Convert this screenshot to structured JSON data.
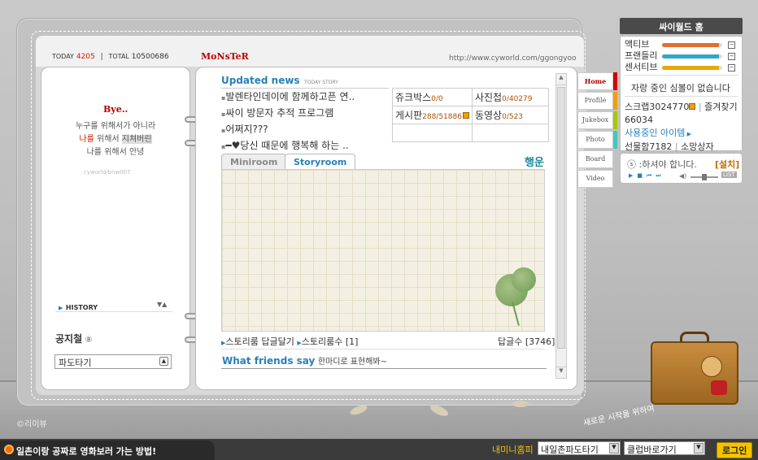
{
  "header": {
    "today_label": "TODAY",
    "today_count": "4205",
    "divider": "|",
    "total_label": "TOTAL",
    "total_count": "10500686",
    "title": "MoNsTeR",
    "url": "http://www.cyworld.com/ggongyoo"
  },
  "left_panel": {
    "bye": "Bye..",
    "poem": {
      "line1": "누구를 위해서가 아니라",
      "line2_highlight": "나를",
      "line2_rest": " 위해서 ",
      "line2_box": "지쳐버린",
      "line3": "나를 위해서 안녕"
    },
    "signature": "cyworld/bnw007",
    "history_label": "HISTORY",
    "notice_title": "공지철",
    "notice_icon": "circled-8",
    "notice_select": "파도타기"
  },
  "main": {
    "updated_news_title": "Updated news",
    "today_story": "TODAY STORY",
    "news": [
      "발렌타인데이에 함께하고픈 연..",
      "싸이 방문자 추적 프로그램",
      "어쩌지???",
      "━♥당신 때문에 행복해 하는 .."
    ],
    "menu_grid": [
      {
        "label": "쥬크박스",
        "count": "0/0"
      },
      {
        "label": "사진첩",
        "count": "0/40279"
      },
      {
        "label": "게시판",
        "count": "288/51886"
      },
      {
        "label": "동영상",
        "count": "0/523"
      }
    ],
    "tabs": [
      "Miniroom",
      "Storyroom"
    ],
    "active_tab": "Storyroom",
    "mood": "행운",
    "story_links": [
      "스토리룸 답글달기",
      "스토리룸수 [1]"
    ],
    "reply_count": "답글수 [3746]",
    "friends_title": "What friends say",
    "friends_text": "한마디로 표현해봐~"
  },
  "side_tabs": [
    "Home",
    "Profile",
    "Jukebox",
    "Photo",
    "Board",
    "Video"
  ],
  "side_tab_colors": [
    "#d40000",
    "#f0a000",
    "#a8c800",
    "#40c8c0",
    "#ffffff",
    "#ffffff"
  ],
  "right_panel": {
    "title": "싸이월드 홈",
    "stats": [
      {
        "label": "액티브",
        "color": "#e07030",
        "level": 0.95
      },
      {
        "label": "프랜들리",
        "color": "#30a8c8",
        "level": 0.95
      },
      {
        "label": "센서티브",
        "color": "#e8a800",
        "level": 0.95
      }
    ],
    "proud": "자랑 중인 심볼이 없습니다",
    "scrap_label": "스크랩",
    "scrap_count": "3024770",
    "fav_label": "즐겨찾기",
    "fav_count": "66034",
    "items_link": "사용중인 아이템",
    "gift_label": "선물함",
    "gift_count": "7182",
    "owner_label": "소망상자"
  },
  "music": {
    "text": "ⓢ :하셔야 합니다.",
    "install": "[설치]",
    "list": "LIST"
  },
  "copyright": "©리이뷰",
  "floor_text": "새로운 시작을 위하여",
  "bottom": {
    "ticker": "일촌이랑 공짜로 영화보러 가는 방법!",
    "my_homepy": "내미니홈피",
    "select1": "내일촌파도타기",
    "select2": "클럽바로가기",
    "login": "로그인"
  },
  "colors": {
    "accent_blue": "#2a7fb8",
    "accent_red": "#cc2200",
    "brand_yellow": "#f4c300"
  }
}
